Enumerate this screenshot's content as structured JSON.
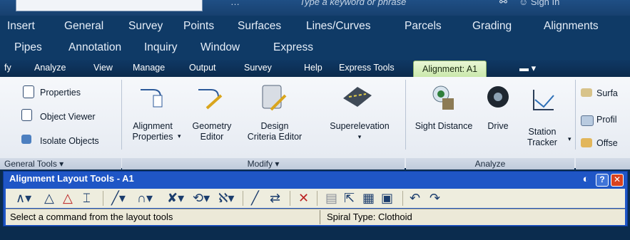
{
  "top_strip": {
    "search_placeholder": "Type a keyword or phrase",
    "sign_in": "Sign In"
  },
  "menu_row1": [
    "Insert",
    "General",
    "Survey",
    "Points",
    "Surfaces",
    "Lines/Curves",
    "Parcels",
    "Grading",
    "Alignments"
  ],
  "menu_row2": [
    "Pipes",
    "Annotation",
    "Inquiry",
    "Window",
    "Express"
  ],
  "ribbon_tabs": [
    "fy",
    "Analyze",
    "View",
    "Manage",
    "Output",
    "Survey",
    "Help",
    "Express Tools",
    "Alignment: A1"
  ],
  "ribbon": {
    "general_tools": {
      "items": [
        "Properties",
        "Object Viewer",
        "Isolate Objects"
      ],
      "title": "General Tools"
    },
    "modify": {
      "items": [
        {
          "line1": "Alignment",
          "line2": "Properties"
        },
        {
          "line1": "Geometry",
          "line2": "Editor"
        },
        {
          "line1": "Design",
          "line2": "Criteria Editor"
        },
        {
          "line1": "Superelevation",
          "line2": ""
        }
      ],
      "title": "Modify"
    },
    "analyze": {
      "items": [
        {
          "line1": "Sight Distance",
          "line2": ""
        },
        {
          "line1": "Drive",
          "line2": ""
        },
        {
          "line1": "Station",
          "line2": "Tracker"
        }
      ],
      "title": "Analyze"
    },
    "launch_pad": {
      "items": [
        "Surfa",
        "Profil",
        "Offse"
      ]
    }
  },
  "layout_tools": {
    "title": "Alignment Layout Tools - A1",
    "status_left": "Select a command from the layout tools",
    "status_right": "Spiral Type: Clothoid"
  },
  "colors": {
    "window_bg": "#0f3a66",
    "active_tab": "#c9e7a9",
    "toolwin_title": "#1f56c6"
  }
}
